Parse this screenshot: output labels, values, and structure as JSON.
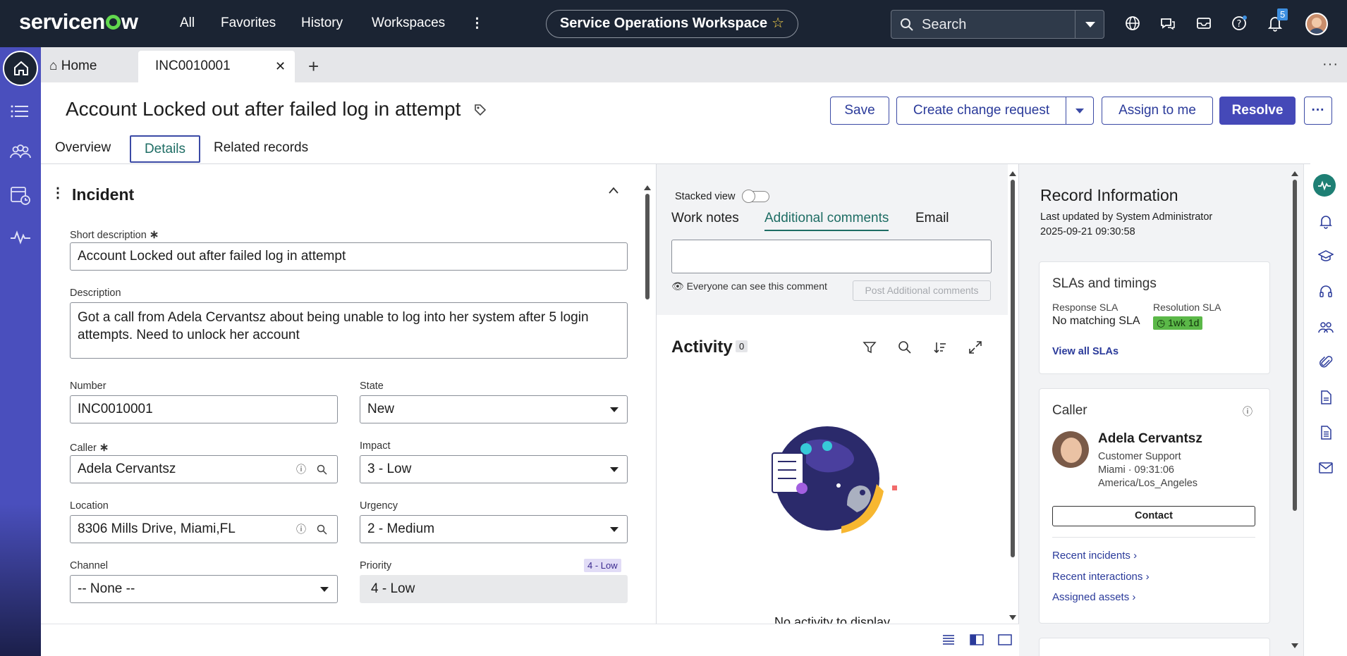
{
  "topbar": {
    "logo": "servicenow",
    "nav": [
      "All",
      "Favorites",
      "History",
      "Workspaces"
    ],
    "workspace": "Service Operations Workspace",
    "search_placeholder": "Search",
    "notification_count": "5"
  },
  "tabs": {
    "home": "Home",
    "incident": "INC0010001"
  },
  "header": {
    "title": "Account Locked out after failed log in attempt",
    "buttons": {
      "save": "Save",
      "create_change": "Create change request",
      "assign": "Assign to me",
      "resolve": "Resolve"
    },
    "subtabs": [
      "Overview",
      "Details",
      "Related records"
    ]
  },
  "form": {
    "section": "Incident",
    "short_desc_label": "Short description",
    "short_desc": "Account Locked out after failed log in attempt",
    "desc_label": "Description",
    "desc": "Got a call from Adela Cervantsz about being unable to log into her system after 5 login attempts. Need to unlock her account",
    "number_label": "Number",
    "number": "INC0010001",
    "state_label": "State",
    "state": "New",
    "caller_label": "Caller",
    "caller": "Adela Cervantsz",
    "impact_label": "Impact",
    "impact": "3 - Low",
    "location_label": "Location",
    "location": "8306 Mills Drive, Miami,FL",
    "urgency_label": "Urgency",
    "urgency": "2 - Medium",
    "channel_label": "Channel",
    "channel": "-- None --",
    "priority_label": "Priority",
    "priority": "4 - Low",
    "priority_badge": "4 - Low"
  },
  "activity": {
    "stacked_view": "Stacked view",
    "tabs": [
      "Work notes",
      "Additional comments",
      "Email"
    ],
    "visibility_note": "Everyone can see this comment",
    "post_button": "Post Additional comments",
    "title": "Activity",
    "count": "0",
    "empty_text": "No activity to display"
  },
  "record_info": {
    "title": "Record Information",
    "updated_by": "Last updated by System Administrator",
    "updated_at": "2025-09-21 09:30:58",
    "sla": {
      "title": "SLAs and timings",
      "response_label": "Response SLA",
      "response_value": "No matching SLA",
      "resolution_label": "Resolution SLA",
      "resolution_value": "1wk 1d",
      "view_all": "View all SLAs"
    },
    "caller": {
      "title": "Caller",
      "name": "Adela Cervantsz",
      "dept": "Customer Support",
      "loc_time": "Miami · 09:31:06",
      "tz": "America/Los_Angeles",
      "contact": "Contact",
      "links": [
        "Recent incidents",
        "Recent interactions",
        "Assigned assets"
      ]
    }
  },
  "colors": {
    "topbar": "#1b2433",
    "rail": "#4a4fbd",
    "accent": "#3b4aa5",
    "active_tab": "#1e6d64",
    "sla_green": "#5bb848"
  }
}
